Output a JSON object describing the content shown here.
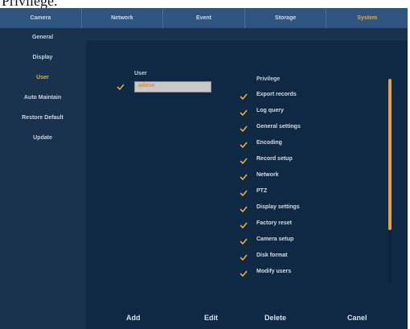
{
  "caption_fragment": "Privilege.",
  "topnav": {
    "tabs": [
      {
        "label": "Camera"
      },
      {
        "label": "Network"
      },
      {
        "label": "Event"
      },
      {
        "label": "Storage"
      },
      {
        "label": "System"
      }
    ],
    "active_tab": "System"
  },
  "sidebar": {
    "items": [
      {
        "label": "General"
      },
      {
        "label": "Display"
      },
      {
        "label": "User"
      },
      {
        "label": "Auto Maintain"
      },
      {
        "label": "Restore Default"
      },
      {
        "label": "Update"
      }
    ],
    "active_item": "User"
  },
  "user_panel": {
    "header": "User",
    "selected_user": "admin"
  },
  "privilege_panel": {
    "header": "Privilege",
    "items": [
      {
        "label": "Export records",
        "checked": true
      },
      {
        "label": "Log query",
        "checked": true
      },
      {
        "label": "General settings",
        "checked": true
      },
      {
        "label": "Encoding",
        "checked": true
      },
      {
        "label": "Record setup",
        "checked": true
      },
      {
        "label": "Network",
        "checked": true
      },
      {
        "label": "PTZ",
        "checked": true
      },
      {
        "label": "Display settings",
        "checked": true
      },
      {
        "label": "Factory reset",
        "checked": true
      },
      {
        "label": "Camera setup",
        "checked": true
      },
      {
        "label": "Disk format",
        "checked": true
      },
      {
        "label": "Modify users",
        "checked": true
      }
    ]
  },
  "actions": {
    "add_label": "Add",
    "edit_label": "Edit",
    "delete_label": "Delete",
    "cancel_label": "Canel"
  },
  "colors": {
    "accent": "#f0a83a",
    "nav_bg": "#2e557f",
    "panel_bg": "#0f2944",
    "sidebar_bg": "#19324e"
  }
}
